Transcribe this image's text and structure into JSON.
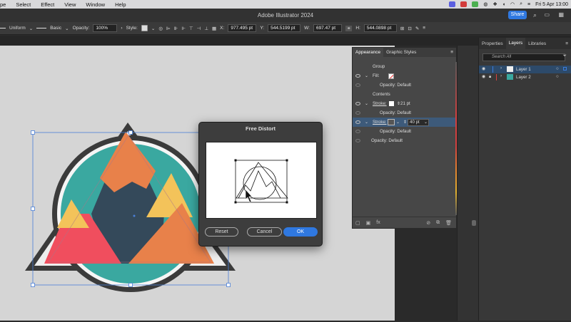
{
  "menubar": {
    "items": [
      "pe",
      "Select",
      "Effect",
      "View",
      "Window",
      "Help"
    ],
    "clock": "Fri 5 Apr  13:00"
  },
  "app": {
    "title": "Adobe Illustrator 2024",
    "share_label": "Share"
  },
  "controlbar": {
    "stroke_profile": "Uniform",
    "brush": "Basic",
    "opacity_label": "Opacity:",
    "opacity_value": "100%",
    "style_label": "Style:",
    "x_label": "X:",
    "x_value": "977.495 pt",
    "y_label": "Y:",
    "y_value": "544.5199 pt",
    "w_label": "W:",
    "w_value": "697.47 pt",
    "h_label": "H:",
    "h_value": "544.0898 pt"
  },
  "appearance": {
    "tabs": [
      "Appearance",
      "Graphic Styles"
    ],
    "group_label": "Group",
    "fill_label": "Fill:",
    "opacity_default": "Opacity: Default",
    "contents_label": "Contents",
    "stroke_label": "Stroke:",
    "stroke1_weight": "21 pt",
    "stroke2_weight": "40 pt"
  },
  "layers": {
    "tabs": [
      "Properties",
      "Layers",
      "Libraries"
    ],
    "search_placeholder": "Search All",
    "items": [
      "Layer 1",
      "Layer 2"
    ]
  },
  "dialog": {
    "title": "Free Distort",
    "reset_label": "Reset",
    "cancel_label": "Cancel",
    "ok_label": "OK"
  },
  "colors": {
    "teal": "#3aa8a0",
    "dark_slate": "#34495a",
    "orange": "#e8814a",
    "yellow": "#f3c35a",
    "red": "#f04e5e",
    "accent_blue": "#2f78e0"
  }
}
